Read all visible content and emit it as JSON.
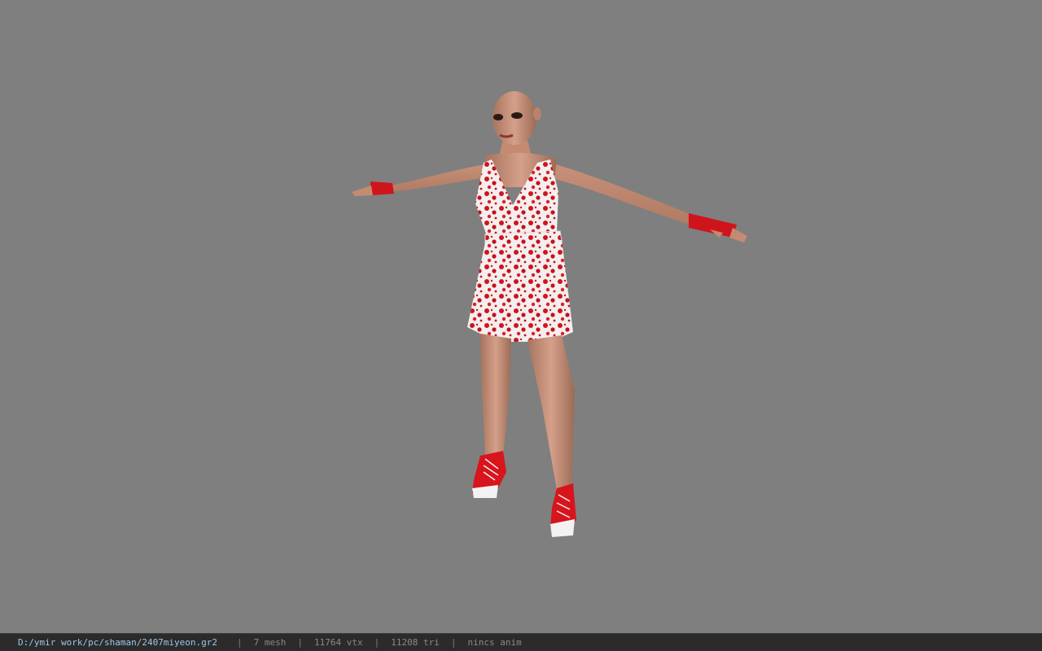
{
  "viewer": {
    "model_path": "D:/ymir work/pc/shaman/2407miyeon.gr2",
    "separator": "|",
    "stats": {
      "mesh": "7 mesh",
      "vertices": "11764 vtx",
      "triangles": "11208 tri",
      "animation": "nincs anim"
    }
  },
  "colors": {
    "background": "#7f7f7f",
    "statusbar": "#2b2b2b",
    "path_text": "#9fc6e6",
    "stats_text": "#8a8a8a",
    "accent_red": "#d8141c"
  }
}
